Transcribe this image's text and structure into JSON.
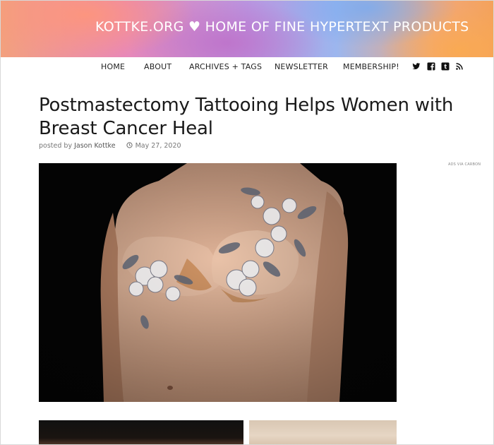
{
  "header": {
    "banner_title": "KOTTKE.ORG ♥ HOME OF FINE HYPERTEXT PRODUCTS"
  },
  "nav": {
    "items": [
      {
        "label": "HOME"
      },
      {
        "label": "ABOUT"
      },
      {
        "label": "ARCHIVES + TAGS"
      },
      {
        "label": "NEWSLETTER"
      },
      {
        "label": "MEMBERSHIP!"
      }
    ],
    "social": [
      "twitter-icon",
      "facebook-icon",
      "tumblr-icon",
      "rss-icon"
    ]
  },
  "post": {
    "title": "Postmastectomy Tattooing Helps Women with Breast Cancer Heal",
    "byline_prefix": "posted by ",
    "author": "Jason Kottke",
    "date": "May 27, 2020"
  },
  "sidebar": {
    "ads_label": "ADS VIA CARBON"
  },
  "colors": {
    "text": "#1a1a1a",
    "meta": "#777777",
    "banner_text": "#ffffff"
  }
}
